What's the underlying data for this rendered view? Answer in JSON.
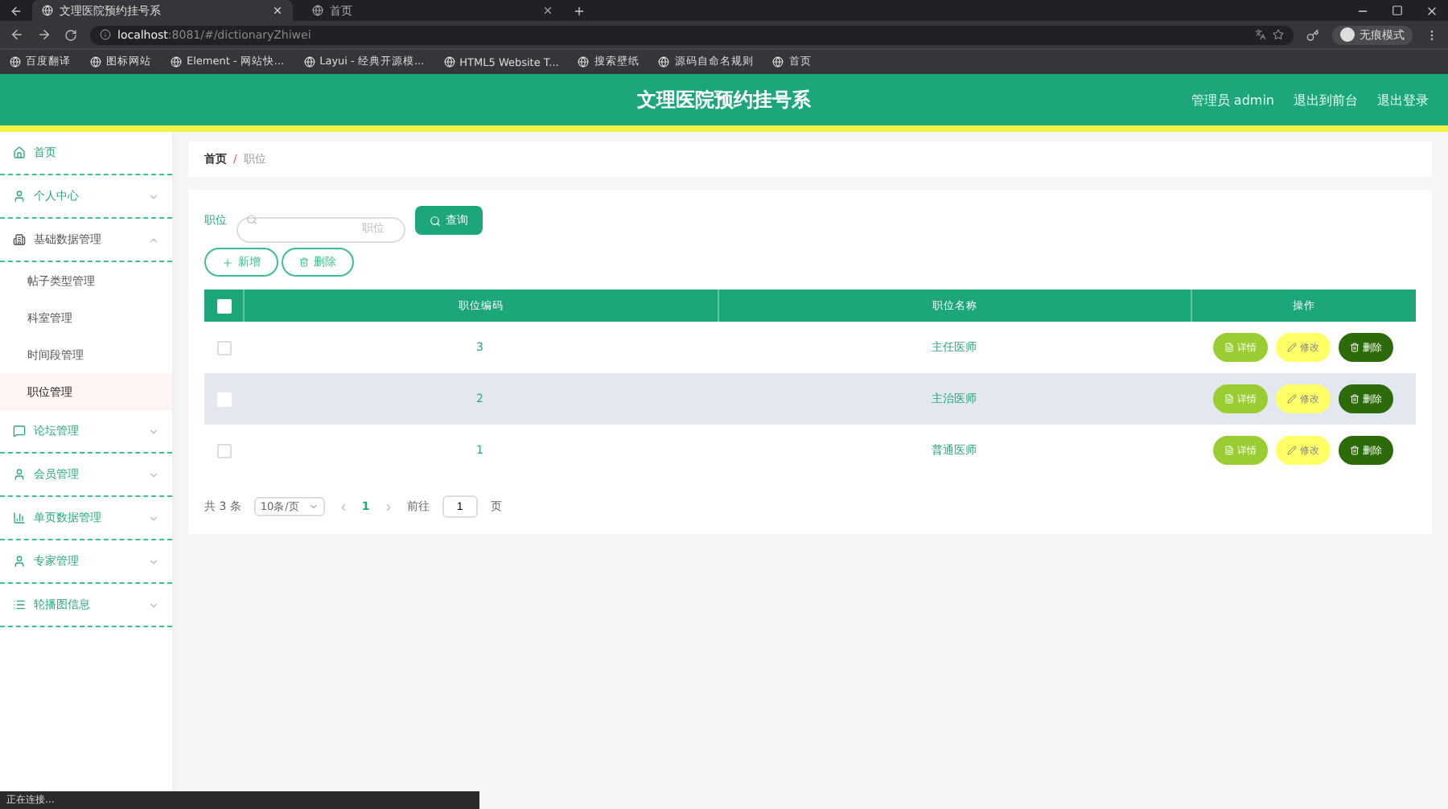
{
  "browser": {
    "tabs": [
      {
        "title": "文理医院预约挂号系",
        "selected": true
      },
      {
        "title": "首页",
        "selected": false
      }
    ],
    "address": {
      "host": "localhost",
      "path": ":8081/#/dictionaryZhiwei"
    },
    "bookmarks": [
      "百度翻译",
      "图标网站",
      "Element - 网站快...",
      "Layui - 经典开源模...",
      "HTML5 Website T...",
      "搜索壁纸",
      "源码自命名规则",
      "首页"
    ],
    "profile": "无痕模式",
    "status": "正在连接..."
  },
  "header": {
    "title": "文理医院预约挂号系",
    "links": [
      "管理员 admin",
      "退出到前台",
      "退出登录"
    ]
  },
  "sidebar": {
    "items": [
      {
        "label": "首页"
      },
      {
        "label": "个人中心",
        "expanded": false
      },
      {
        "label": "基础数据管理",
        "expanded": true,
        "children": [
          {
            "label": "帖子类型管理",
            "selected": false
          },
          {
            "label": "科室管理",
            "selected": false
          },
          {
            "label": "时间段管理",
            "selected": false
          },
          {
            "label": "职位管理",
            "selected": true
          }
        ]
      },
      {
        "label": "论坛管理",
        "expanded": false
      },
      {
        "label": "会员管理",
        "expanded": false
      },
      {
        "label": "单页数据管理",
        "expanded": false
      },
      {
        "label": "专家管理",
        "expanded": false
      },
      {
        "label": "轮播图信息",
        "expanded": false
      }
    ]
  },
  "breadcrumb": {
    "items": [
      "首页",
      "职位"
    ],
    "separator": "/"
  },
  "search": {
    "label": "职位",
    "placeholder": "职位",
    "button": "查询"
  },
  "actions": [
    {
      "label": "新增",
      "kind": "add"
    },
    {
      "label": "删除",
      "kind": "delete"
    }
  ],
  "table": {
    "all_checked": false,
    "columns": [
      "职位编码",
      "职位名称",
      "操作"
    ],
    "rows": [
      {
        "code": "3",
        "name": "主任医师",
        "checked": false,
        "hovered": false,
        "actions": [
          {
            "label": "详情",
            "kind": "detail"
          },
          {
            "label": "修改",
            "kind": "edit"
          },
          {
            "label": "删除",
            "kind": "delete"
          }
        ]
      },
      {
        "code": "2",
        "name": "主治医师",
        "checked": false,
        "hovered": true,
        "actions": [
          {
            "label": "详情",
            "kind": "detail"
          },
          {
            "label": "修改",
            "kind": "edit"
          },
          {
            "label": "删除",
            "kind": "delete"
          }
        ]
      },
      {
        "code": "1",
        "name": "普通医师",
        "checked": false,
        "hovered": false,
        "actions": [
          {
            "label": "详情",
            "kind": "detail"
          },
          {
            "label": "修改",
            "kind": "edit"
          },
          {
            "label": "删除",
            "kind": "delete"
          }
        ]
      }
    ]
  },
  "pagination": {
    "total": "共 3 条",
    "page_size": "10条/页",
    "pages": [
      {
        "label": "1",
        "selected": true
      }
    ],
    "goto_label": "前往",
    "goto_value": "1",
    "goto_suffix": "页"
  }
}
